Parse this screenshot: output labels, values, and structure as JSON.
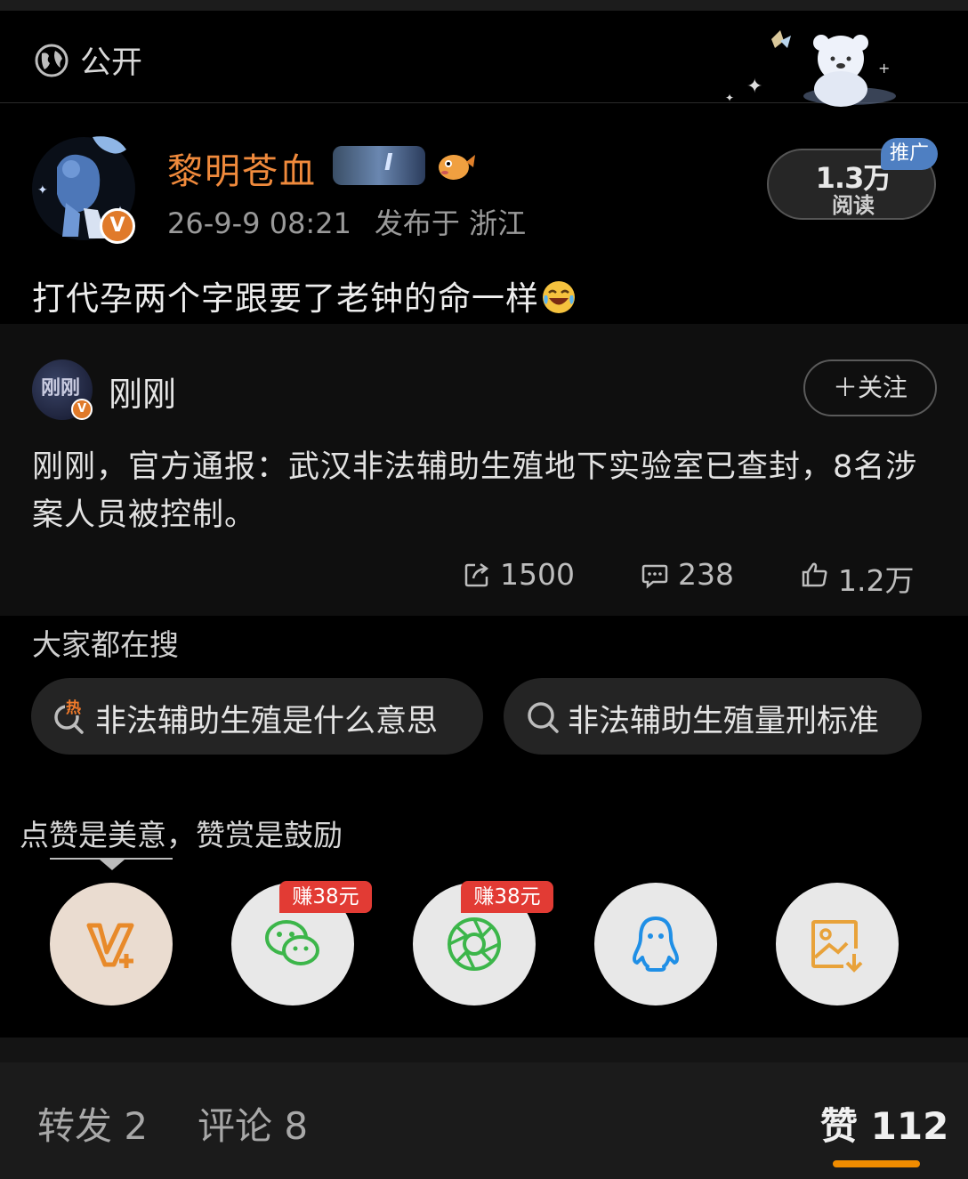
{
  "visibility": {
    "label": "公开",
    "icon": "globe-icon"
  },
  "author": {
    "name": "黎明苍血",
    "verified_badge": "V",
    "timestamp": "26-9-9 08:21",
    "location": "发布于 浙江",
    "medal_text": "I"
  },
  "reads": {
    "count": "1.3万",
    "label": "阅读",
    "promo": "推广"
  },
  "post": {
    "text": "打代孕两个字跟要了老钟的命一样"
  },
  "quoted": {
    "avatar_text": "刚刚",
    "verified_badge": "V",
    "name": "刚刚",
    "follow_label": "＋关注",
    "text": "刚刚，官方通报：武汉非法辅助生殖地下实验室已查封，8名涉案人员被控制。",
    "reposts": "1500",
    "comments": "238",
    "likes": "1.2万"
  },
  "searches": {
    "title": "大家都在搜",
    "hot_icon_text": "热",
    "items": [
      "非法辅助生殖是什么意思",
      "非法辅助生殖量刑标准"
    ]
  },
  "share": {
    "tip": "点赞是美意，赞赏是鼓励",
    "earn_badge": "赚38元",
    "buttons": [
      "v-plus-reward-icon",
      "wechat-icon",
      "moments-icon",
      "qq-icon",
      "save-image-icon"
    ]
  },
  "tabs": {
    "repost": "转发 2",
    "comment": "评论 8",
    "like": "赞 112"
  },
  "colors": {
    "accent_orange": "#f08c00",
    "author_name": "#f08a3c",
    "promo_blue": "#4e7fc2",
    "earn_red": "#e23b34"
  }
}
